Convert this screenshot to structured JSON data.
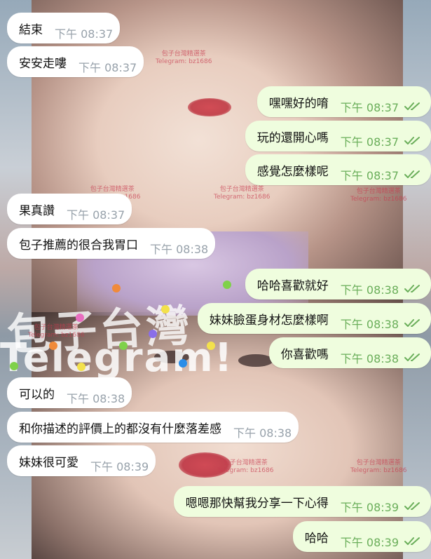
{
  "background": {
    "watermark_large": "包子台灣",
    "watermark_telegram": "Telegram!",
    "watermark_small_line1": "包子台灣精選茶",
    "watermark_small_line2": "Telegram: bz1686"
  },
  "colors": {
    "incoming_bubble": "#ffffff",
    "outgoing_bubble": "#effdde",
    "time_incoming": "#98a2ab",
    "time_outgoing": "#6aae5a",
    "read_check": "#6aae5a"
  },
  "messages": [
    {
      "direction": "in",
      "text": "結束",
      "time": "下午 08:37"
    },
    {
      "direction": "in",
      "text": "安安走嘍",
      "time": "下午 08:37"
    },
    {
      "direction": "out",
      "text": "嘿嘿好的唷",
      "time": "下午 08:37",
      "status": "read"
    },
    {
      "direction": "out",
      "text": "玩的還開心嗎",
      "time": "下午 08:37",
      "status": "read"
    },
    {
      "direction": "out",
      "text": "感覺怎麼樣呢",
      "time": "下午 08:37",
      "status": "read"
    },
    {
      "direction": "in",
      "text": "果真讚",
      "time": "下午 08:37"
    },
    {
      "direction": "in",
      "text": "包子推薦的很合我胃口",
      "time": "下午 08:38"
    },
    {
      "direction": "out",
      "text": "哈哈喜歡就好",
      "time": "下午 08:38",
      "status": "read"
    },
    {
      "direction": "out",
      "text": "妹妹臉蛋身材怎麼樣啊",
      "time": "下午 08:38",
      "status": "read"
    },
    {
      "direction": "out",
      "text": "你喜歡嗎",
      "time": "下午 08:38",
      "status": "read"
    },
    {
      "direction": "in",
      "text": "可以的",
      "time": "下午 08:38"
    },
    {
      "direction": "in",
      "text": "和你描述的評價上的都沒有什麼落差感",
      "time": "下午 08:38"
    },
    {
      "direction": "in",
      "text": "妹妹很可愛",
      "time": "下午 08:39"
    },
    {
      "direction": "out",
      "text": "嗯嗯那快幫我分享一下心得",
      "time": "下午 08:39",
      "status": "read"
    },
    {
      "direction": "out",
      "text": "哈哈",
      "time": "下午 08:39",
      "status": "read"
    }
  ]
}
